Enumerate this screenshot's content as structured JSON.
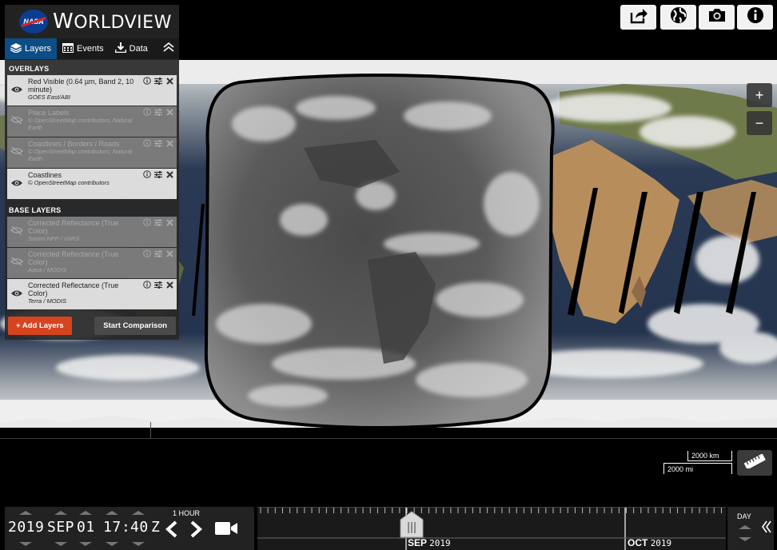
{
  "app": {
    "brand_prefix": "W",
    "brand_rest": "ORLDVIEW",
    "nasa_text": "NASA"
  },
  "tabs": [
    {
      "label": "Layers",
      "icon": "layers-icon",
      "active": true
    },
    {
      "label": "Events",
      "icon": "calendar-icon",
      "active": false
    },
    {
      "label": "Data",
      "icon": "download-icon",
      "active": false
    }
  ],
  "overlays": {
    "title": "OVERLAYS",
    "items": [
      {
        "title": "Red Visible (0.64 µm, Band 2, 10 minute)",
        "sub": "GOES East/ABI",
        "visible": true
      },
      {
        "title": "Place Labels",
        "sub": "© OpenStreetMap contributors, Natural Earth",
        "visible": false
      },
      {
        "title": "Coastlines / Borders / Roads",
        "sub": "© OpenStreetMap contributors, Natural Earth",
        "visible": false
      },
      {
        "title": "Coastlines",
        "sub": "© OpenStreetMap contributors",
        "visible": true
      }
    ]
  },
  "base_layers": {
    "title": "BASE LAYERS",
    "items": [
      {
        "title": "Corrected Reflectance (True Color)",
        "sub": "Suomi NPP / VIIRS",
        "visible": false
      },
      {
        "title": "Corrected Reflectance (True Color)",
        "sub": "Aqua / MODIS",
        "visible": false
      },
      {
        "title": "Corrected Reflectance (True Color)",
        "sub": "Terra / MODIS",
        "visible": true
      }
    ]
  },
  "buttons": {
    "add_layers": "+ Add Layers",
    "start_comparison": "Start Comparison"
  },
  "toolbar": [
    "share-icon",
    "projection-icon",
    "camera-icon",
    "info-icon"
  ],
  "zoom": {
    "in": "+",
    "out": "−"
  },
  "scale": {
    "km": "2000 km",
    "mi": "2000 mi"
  },
  "date": {
    "year": "2019",
    "month": "SEP",
    "day": "01",
    "hour": "17",
    "sep": ":",
    "minute": "40",
    "zone": "Z"
  },
  "interval": "1 HOUR",
  "timeline": {
    "month1": "SEP",
    "year1": "2019",
    "month2": "OCT",
    "year2": "2019",
    "zoom_level": "DAY"
  },
  "colors": {
    "accent": "#0d4d86",
    "add_button": "#d5441f"
  }
}
